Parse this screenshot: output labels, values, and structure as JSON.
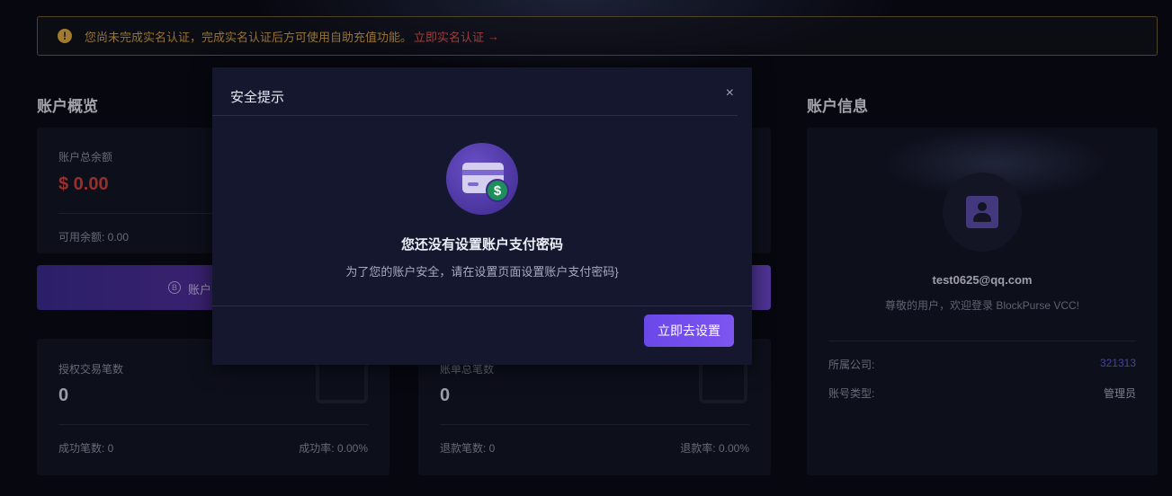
{
  "alert": {
    "message": "您尚未完成实名认证，完成实名认证后方可使用自助充值功能。",
    "link": "立即实名认证",
    "arrow": "→"
  },
  "overview": {
    "title": "账户概览",
    "total_balance_label": "账户总余额",
    "total_balance_value": "$ 0.00",
    "available_label": "可用余额: 0.00",
    "charge_label": "账户"
  },
  "auth_card": {
    "label": "授权交易笔数",
    "value": "0",
    "success_count": "成功笔数: 0",
    "success_rate": "成功率: 0.00%"
  },
  "bill_card": {
    "label": "账单总笔数",
    "value": "0",
    "refund_count": "退款笔数: 0",
    "refund_rate": "退款率: 0.00%"
  },
  "account_info": {
    "title": "账户信息",
    "email": "test0625@qq.com",
    "welcome": "尊敬的用户，欢迎登录 BlockPurse VCC!",
    "company_label": "所属公司:",
    "company_value": "321313",
    "type_label": "账号类型:",
    "type_value": "管理员"
  },
  "modal": {
    "title": "安全提示",
    "close": "×",
    "heading": "您还没有设置账户支付密码",
    "description": "为了您的账户安全，请在设置页面设置账户支付密码}",
    "button": "立即去设置",
    "dollar": "$"
  },
  "colors": {
    "accent": "#6a48e8",
    "balance_red": "#c8413e",
    "warning": "#c89a45",
    "link_blue": "#5a5fd0"
  }
}
